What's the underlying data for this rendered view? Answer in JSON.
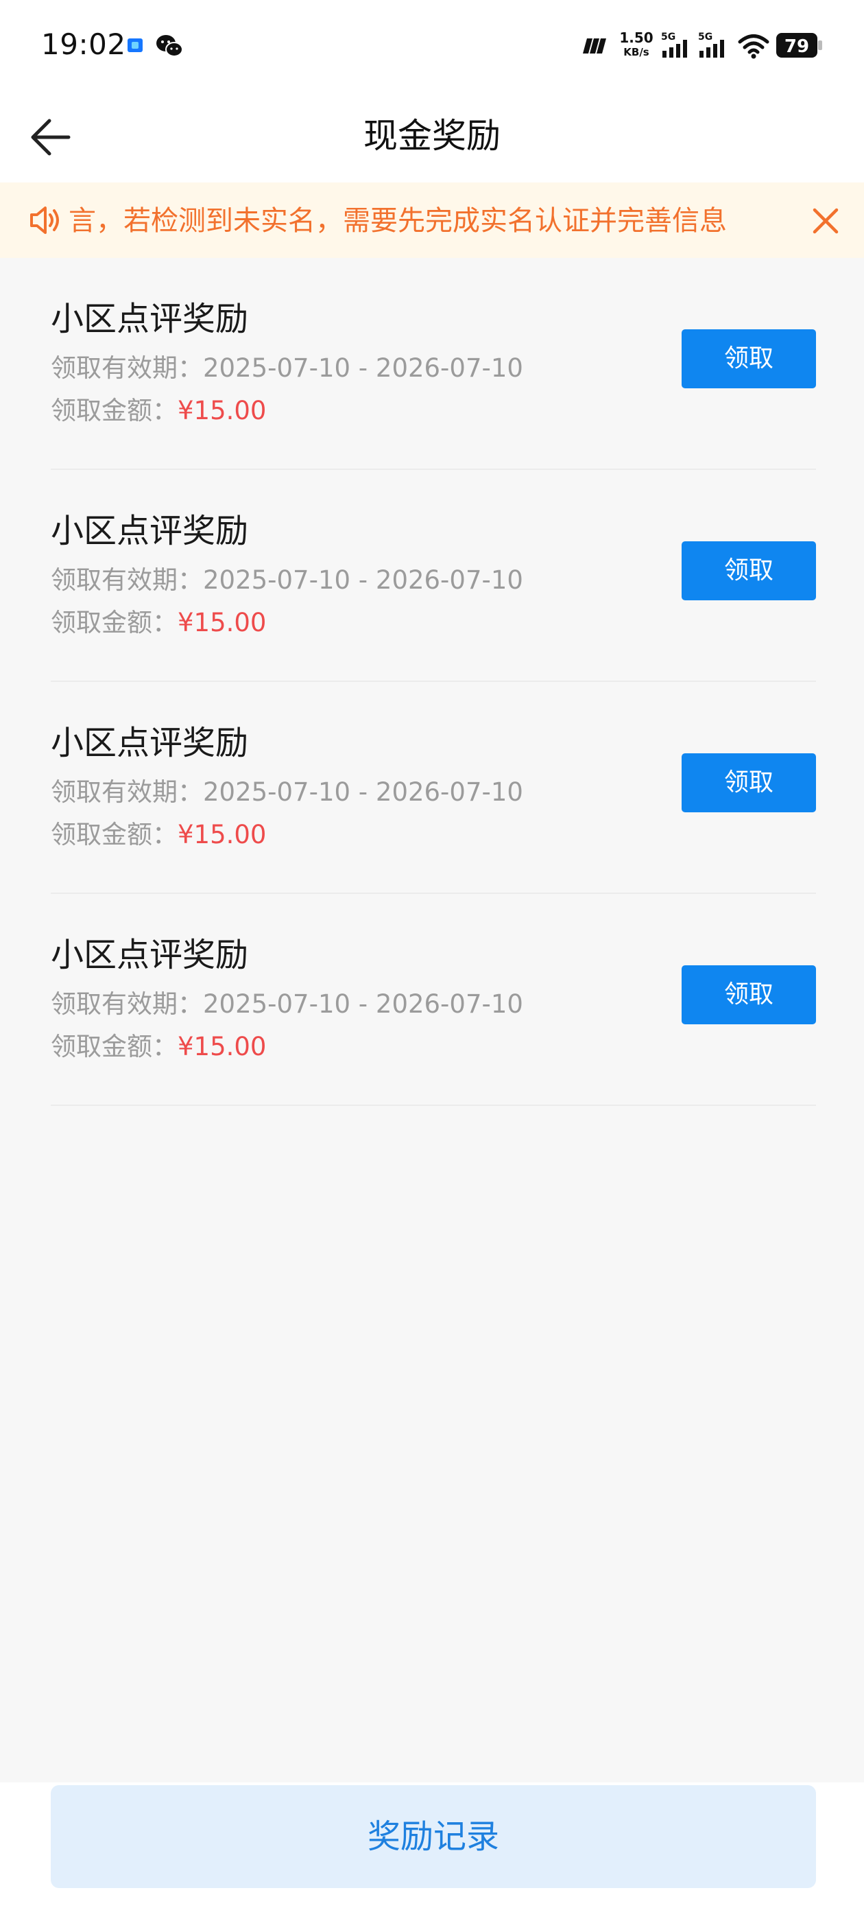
{
  "status_bar": {
    "time": "19:02",
    "net_speed_value": "1.50",
    "net_speed_unit": "KB/s",
    "sim1_label": "5G",
    "sim2_label": "5G",
    "battery": "79",
    "icons": [
      "app-notification-icon",
      "wechat-icon",
      "hd-icon",
      "signal-icon",
      "wifi-icon",
      "battery-icon"
    ]
  },
  "header": {
    "title": "现金奖励",
    "back_icon": "arrow-left-icon"
  },
  "notice": {
    "text": "言，若检测到未实名，需要先完成实名认证并完善信息",
    "icon": "speaker-icon",
    "close_icon": "close-icon",
    "color": "#f2712d",
    "background": "#fff8ea"
  },
  "rewards": [
    {
      "title": "小区点评奖励",
      "period_label": "领取有效期：",
      "period": "2025-07-10 - 2026-07-10",
      "amount_label": "领取金额：",
      "amount": "¥15.00",
      "button": "领取"
    },
    {
      "title": "小区点评奖励",
      "period_label": "领取有效期：",
      "period": "2025-07-10 - 2026-07-10",
      "amount_label": "领取金额：",
      "amount": "¥15.00",
      "button": "领取"
    },
    {
      "title": "小区点评奖励",
      "period_label": "领取有效期：",
      "period": "2025-07-10 - 2026-07-10",
      "amount_label": "领取金额：",
      "amount": "¥15.00",
      "button": "领取"
    },
    {
      "title": "小区点评奖励",
      "period_label": "领取有效期：",
      "period": "2025-07-10 - 2026-07-10",
      "amount_label": "领取金额：",
      "amount": "¥15.00",
      "button": "领取"
    }
  ],
  "footer": {
    "records_button": "奖励记录"
  },
  "colors": {
    "accent": "#0f86f0",
    "amount": "#ee4b4b",
    "secondary_text": "#9b9b9b",
    "records_bg": "#e2effc",
    "records_text": "#1e80df"
  }
}
